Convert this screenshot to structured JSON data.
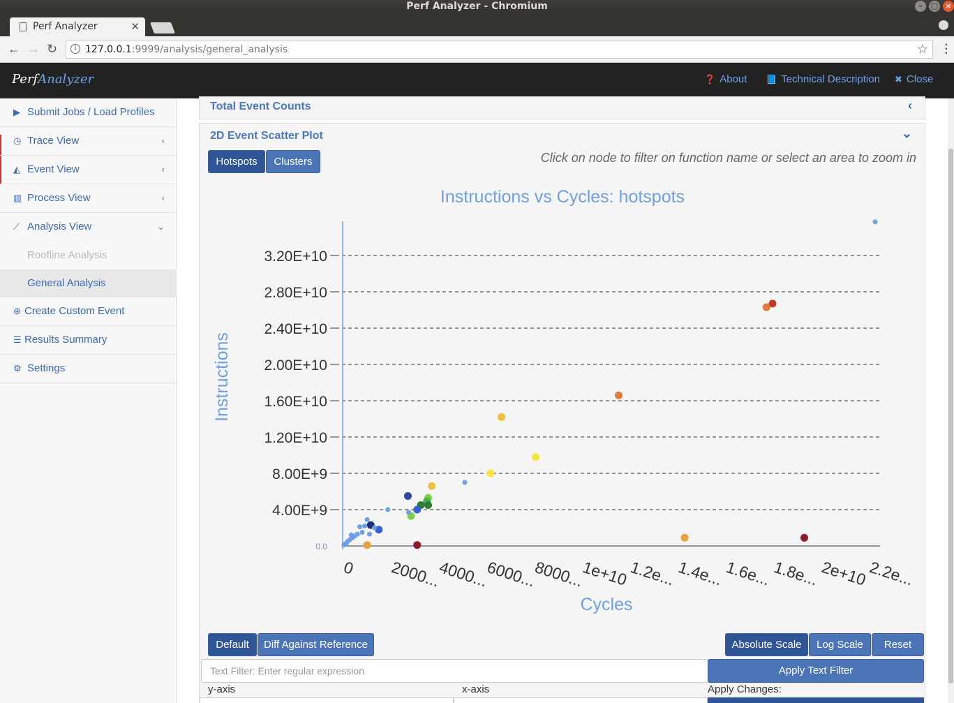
{
  "window": {
    "title": "Perf Analyzer - Chromium"
  },
  "browser": {
    "tab_title": "Perf Analyzer",
    "url_host": "127.0.0.1",
    "url_rest": ":9999/analysis/general_analysis"
  },
  "header": {
    "brand_part1": "Perf",
    "brand_part2": "Analyzer",
    "links": {
      "about": "About",
      "technical": "Technical Description",
      "close": "Close"
    }
  },
  "sidebar": {
    "items": [
      {
        "label": "Submit Jobs / Load Profiles",
        "icon": "play-icon"
      },
      {
        "label": "Trace View",
        "icon": "clock-icon"
      },
      {
        "label": "Event View",
        "icon": "area-chart-icon"
      },
      {
        "label": "Process View",
        "icon": "bar-chart-icon"
      },
      {
        "label": "Analysis View",
        "icon": "line-chart-icon"
      }
    ],
    "subitems": [
      {
        "label": "Roofline Analysis"
      },
      {
        "label": "General Analysis"
      }
    ],
    "bottom_items": [
      {
        "label": "Create Custom Event",
        "icon": "plus-circle-icon"
      },
      {
        "label": "Results Summary",
        "icon": "list-icon"
      },
      {
        "label": "Settings",
        "icon": "gear-icon"
      }
    ]
  },
  "panels": {
    "total_event_counts": "Total Event Counts",
    "scatter_title": "2D Event Scatter Plot"
  },
  "scatter": {
    "mode_buttons": {
      "hotspots": "Hotspots",
      "clusters": "Clusters"
    },
    "hint": "Click on node to filter on function name or select an area to zoom in",
    "controls": {
      "default": "Default",
      "diff": "Diff Against Reference",
      "absolute": "Absolute Scale",
      "log": "Log Scale",
      "reset": "Reset",
      "text_filter_placeholder": "Text Filter: Enter regular expression",
      "apply_text_filter": "Apply Text Filter",
      "y_axis_label": "y-axis",
      "x_axis_label": "x-axis",
      "apply_changes": "Apply Changes:"
    }
  },
  "chart_data": {
    "type": "scatter",
    "title": "Instructions vs Cycles: hotspots",
    "xlabel": "Cycles",
    "ylabel": "Instructions",
    "xlim": [
      0,
      22000000000
    ],
    "ylim": [
      0,
      36000000000
    ],
    "x_tick_labels": [
      "0",
      "2000...",
      "4000...",
      "6000...",
      "8000...",
      "1e+10",
      "1.2e...",
      "1.4e...",
      "1.6e...",
      "1.8e...",
      "2e+10",
      "2.2e..."
    ],
    "y_tick_labels": [
      "0.0",
      "4.00E+9",
      "8.00E+9",
      "1.20E+10",
      "1.60E+10",
      "2.00E+10",
      "2.40E+10",
      "2.80E+10",
      "3.20E+10"
    ],
    "grid": "horizontal dashed",
    "points": [
      {
        "x": 21800000000,
        "y": 35700000000,
        "color": "#6fa0e6",
        "r": 3.5
      },
      {
        "x": 17600000000,
        "y": 26700000000,
        "color": "#c0392b",
        "r": 5.5
      },
      {
        "x": 17350000000,
        "y": 26300000000,
        "color": "#e07b39",
        "r": 5.5
      },
      {
        "x": 11300000000,
        "y": 16600000000,
        "color": "#e07b39",
        "r": 5.5
      },
      {
        "x": 6500000000,
        "y": 14200000000,
        "color": "#f0c040",
        "r": 5.5
      },
      {
        "x": 7900000000,
        "y": 9800000000,
        "color": "#f5e642",
        "r": 5.5
      },
      {
        "x": 6050000000,
        "y": 8000000000,
        "color": "#f5e642",
        "r": 5.5
      },
      {
        "x": 5000000000,
        "y": 7000000000,
        "color": "#6fa0e6",
        "r": 3.5
      },
      {
        "x": 3650000000,
        "y": 6600000000,
        "color": "#f0c040",
        "r": 5.5
      },
      {
        "x": 2670000000,
        "y": 5500000000,
        "color": "#2a4a9c",
        "r": 5.5
      },
      {
        "x": 3500000000,
        "y": 5300000000,
        "color": "#7fd040",
        "r": 5.5
      },
      {
        "x": 3450000000,
        "y": 4900000000,
        "color": "#4caf50",
        "r": 5.5
      },
      {
        "x": 3200000000,
        "y": 4500000000,
        "color": "#2e7d32",
        "r": 5.5
      },
      {
        "x": 3500000000,
        "y": 4500000000,
        "color": "#2e7d32",
        "r": 5.5
      },
      {
        "x": 3050000000,
        "y": 4000000000,
        "color": "#3a5fd0",
        "r": 5.5
      },
      {
        "x": 1850000000,
        "y": 4000000000,
        "color": "#6fa0e6",
        "r": 3.5
      },
      {
        "x": 2800000000,
        "y": 3300000000,
        "color": "#7fd040",
        "r": 5.5
      },
      {
        "x": 2700000000,
        "y": 3700000000,
        "color": "#6fa0e6",
        "r": 3.5
      },
      {
        "x": 1150000000,
        "y": 2300000000,
        "color": "#1a3070",
        "r": 5.5
      },
      {
        "x": 1480000000,
        "y": 1800000000,
        "color": "#3a5fd0",
        "r": 5.5
      },
      {
        "x": 1300000000,
        "y": 2000000000,
        "color": "#6fa0e6",
        "r": 3.5
      },
      {
        "x": 1000000000,
        "y": 2900000000,
        "color": "#6fa0e6",
        "r": 3.5
      },
      {
        "x": 900000000,
        "y": 2200000000,
        "color": "#6fa0e6",
        "r": 3.5
      },
      {
        "x": 700000000,
        "y": 2100000000,
        "color": "#6fa0e6",
        "r": 3.5
      },
      {
        "x": 1100000000,
        "y": 1300000000,
        "color": "#6fa0e6",
        "r": 3.5
      },
      {
        "x": 800000000,
        "y": 1500000000,
        "color": "#6fa0e6",
        "r": 3.5
      },
      {
        "x": 600000000,
        "y": 1300000000,
        "color": "#6fa0e6",
        "r": 3.5
      },
      {
        "x": 500000000,
        "y": 1100000000,
        "color": "#6fa0e6",
        "r": 3.5
      },
      {
        "x": 400000000,
        "y": 900000000,
        "color": "#6fa0e6",
        "r": 3.5
      },
      {
        "x": 350000000,
        "y": 1200000000,
        "color": "#6fa0e6",
        "r": 3.5
      },
      {
        "x": 300000000,
        "y": 700000000,
        "color": "#6fa0e6",
        "r": 3.5
      },
      {
        "x": 200000000,
        "y": 500000000,
        "color": "#6fa0e6",
        "r": 3.5
      },
      {
        "x": 150000000,
        "y": 300000000,
        "color": "#6fa0e6",
        "r": 3.5
      },
      {
        "x": 100000000,
        "y": 200000000,
        "color": "#6fa0e6",
        "r": 3.5
      },
      {
        "x": 50000000,
        "y": 100000000,
        "color": "#6fa0e6",
        "r": 3.5
      },
      {
        "x": 1000000000,
        "y": 100000000,
        "color": "#e6a23c",
        "r": 5.5
      },
      {
        "x": 3050000000,
        "y": 100000000,
        "color": "#8e1b2a",
        "r": 5.5
      },
      {
        "x": 14000000000,
        "y": 900000000,
        "color": "#e6a23c",
        "r": 5.5
      },
      {
        "x": 18900000000,
        "y": 900000000,
        "color": "#8e1b2a",
        "r": 5.5
      }
    ]
  }
}
